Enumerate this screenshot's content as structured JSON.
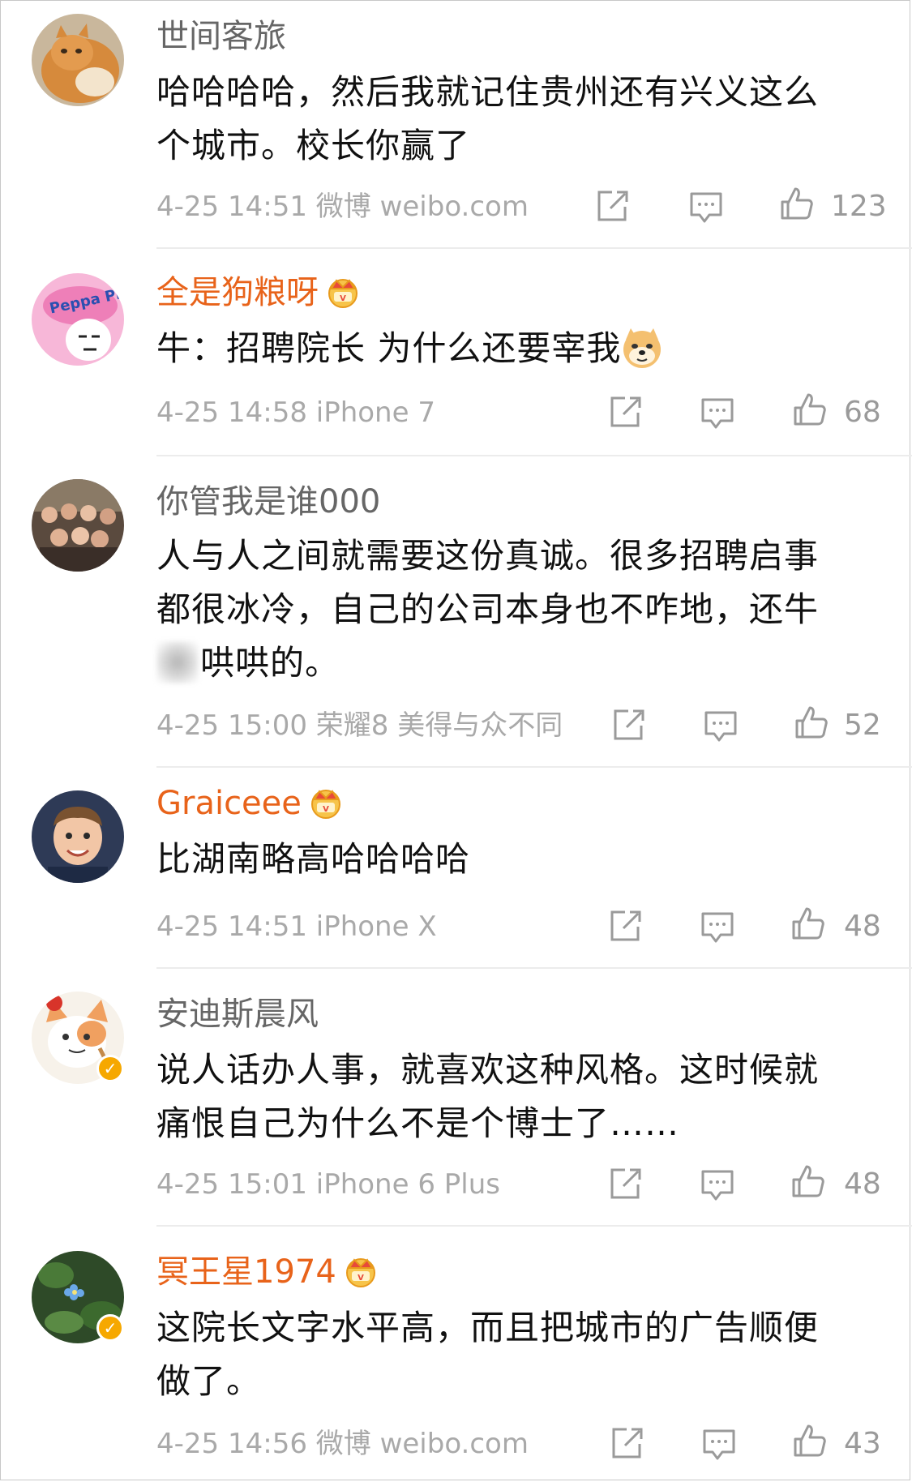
{
  "comments": [
    {
      "username": "世间客旅",
      "vip": false,
      "verified": false,
      "avatar": "cat-avatar",
      "content_lines": [
        "哈哈哈哈，然后我就记住贵州还有兴义这么",
        "个城市。校长你赢了"
      ],
      "meta": "4-25 14:51 微博 weibo.com",
      "likes": "123"
    },
    {
      "username": "全是狗粮呀",
      "vip": true,
      "verified": false,
      "avatar": "peppa-pig-avatar",
      "content": "牛：招聘院长 为什么还要宰我",
      "emoji": "doge-emoji",
      "meta": "4-25 14:58 iPhone 7",
      "likes": "68"
    },
    {
      "username": "你管我是谁000",
      "vip": false,
      "verified": false,
      "avatar": "group-photo-avatar",
      "content_lines": [
        "人与人之间就需要这份真诚。很多招聘启事",
        "都很冰冷，自己的公司本身也不咋地，还牛",
        "哄哄的。"
      ],
      "meta": "4-25 15:00 荣耀8 美得与众不同",
      "likes": "52"
    },
    {
      "username": "Graiceee",
      "vip": true,
      "verified": false,
      "avatar": "child-avatar",
      "content": "比湖南略高哈哈哈哈",
      "meta": "4-25 14:51 iPhone X",
      "likes": "48"
    },
    {
      "username": "安迪斯晨风",
      "vip": false,
      "verified": true,
      "avatar": "cartoon-cat-avatar",
      "content_lines": [
        "说人话办人事，就喜欢这种风格。这时候就",
        "痛恨自己为什么不是个博士了……"
      ],
      "meta": "4-25 15:01 iPhone 6 Plus",
      "likes": "48"
    },
    {
      "username": "冥王星1974",
      "vip": true,
      "verified": true,
      "avatar": "flower-avatar",
      "content_lines": [
        "这院长文字水平高，而且把城市的广告顺便",
        "做了。"
      ],
      "meta": "4-25 14:56 微博 weibo.com",
      "likes": "43"
    }
  ],
  "colors": {
    "vip_name": "#e8631a",
    "normal_name": "#666666",
    "meta": "#a9a9a9",
    "verified": "#f6a800"
  },
  "icons": [
    "share-icon",
    "comment-icon",
    "like-icon",
    "crown-icon",
    "verified-icon"
  ]
}
